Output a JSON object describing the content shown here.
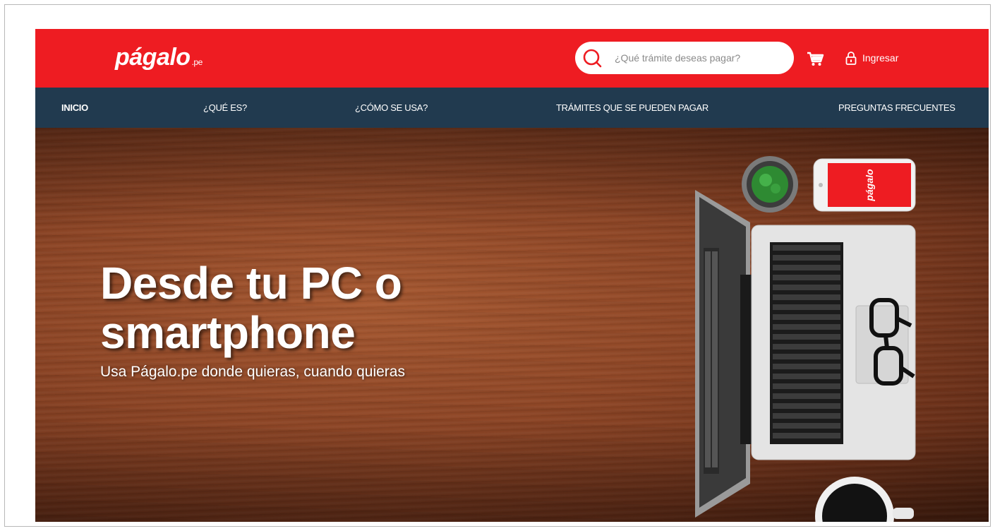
{
  "header": {
    "logo_text": "págalo",
    "logo_suffix": ".pe",
    "search": {
      "placeholder": "¿Qué trámite deseas pagar?"
    },
    "login_label": "Ingresar"
  },
  "nav": {
    "items": [
      {
        "label": "INICIO"
      },
      {
        "label": "¿QUÉ ES?"
      },
      {
        "label": "¿CÓMO SE USA?"
      },
      {
        "label": "TRÁMITES QUE SE PUEDEN PAGAR"
      },
      {
        "label": "PREGUNTAS FRECUENTES"
      }
    ]
  },
  "hero": {
    "headline": "Desde tu PC o smartphone",
    "subline": "Usa Págalo.pe donde quieras, cuando quieras",
    "phone_logo": "págalo"
  },
  "colors": {
    "brand_red": "#ee1c22",
    "nav_navy": "#213a4f"
  },
  "icons": [
    "search-icon",
    "cart-icon",
    "lock-icon"
  ]
}
